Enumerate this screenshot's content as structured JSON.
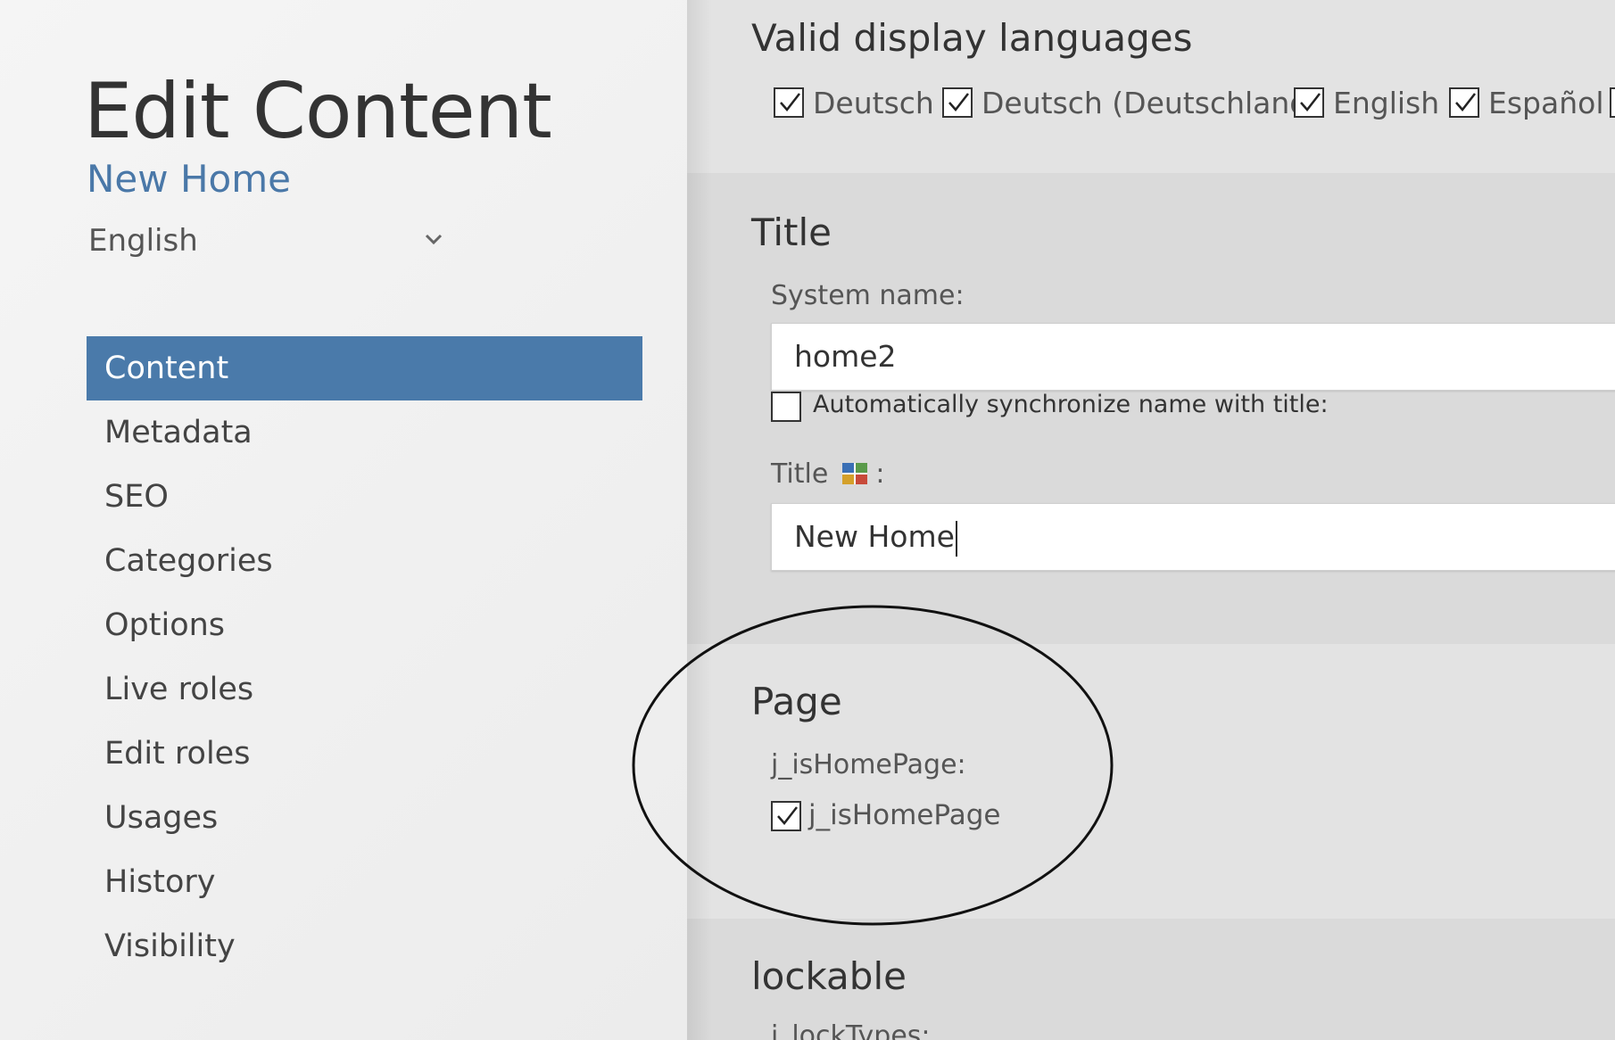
{
  "sidebar": {
    "title": "Edit Content",
    "content_name": "New Home",
    "language_select": {
      "value": "English"
    },
    "nav_items": [
      "Content",
      "Metadata",
      "SEO",
      "Categories",
      "Options",
      "Live roles",
      "Edit roles",
      "Usages",
      "History",
      "Visibility"
    ],
    "active_item": "Content"
  },
  "main": {
    "languages": {
      "heading": "Valid display languages",
      "options": [
        {
          "label": "Deutsch",
          "checked": true
        },
        {
          "label": "Deutsch (Deutschland)",
          "checked": true
        },
        {
          "label": "English",
          "checked": true
        },
        {
          "label": "Español",
          "checked": true
        }
      ]
    },
    "title_section": {
      "heading": "Title",
      "system_name_label": "System name:",
      "system_name_value": "home2",
      "sync_label": "Automatically synchronize name with title:",
      "sync_checked": false,
      "title_label": "Title",
      "title_label_suffix": ":",
      "title_value": "New Home"
    },
    "page_section": {
      "heading": "Page",
      "field_label": "j_isHomePage:",
      "checkbox_label": "j_isHomePage",
      "checked": true
    },
    "lockable_section": {
      "heading": "lockable",
      "field_label": "j_lockTypes:"
    }
  },
  "colors": {
    "accent": "#4a7aaa",
    "link": "#4a78a8",
    "annotation": "#111111"
  },
  "icons": {
    "chevron": "chevron-down-icon",
    "checkmark": "checkmark-icon",
    "flag": "language-flag-icon"
  }
}
